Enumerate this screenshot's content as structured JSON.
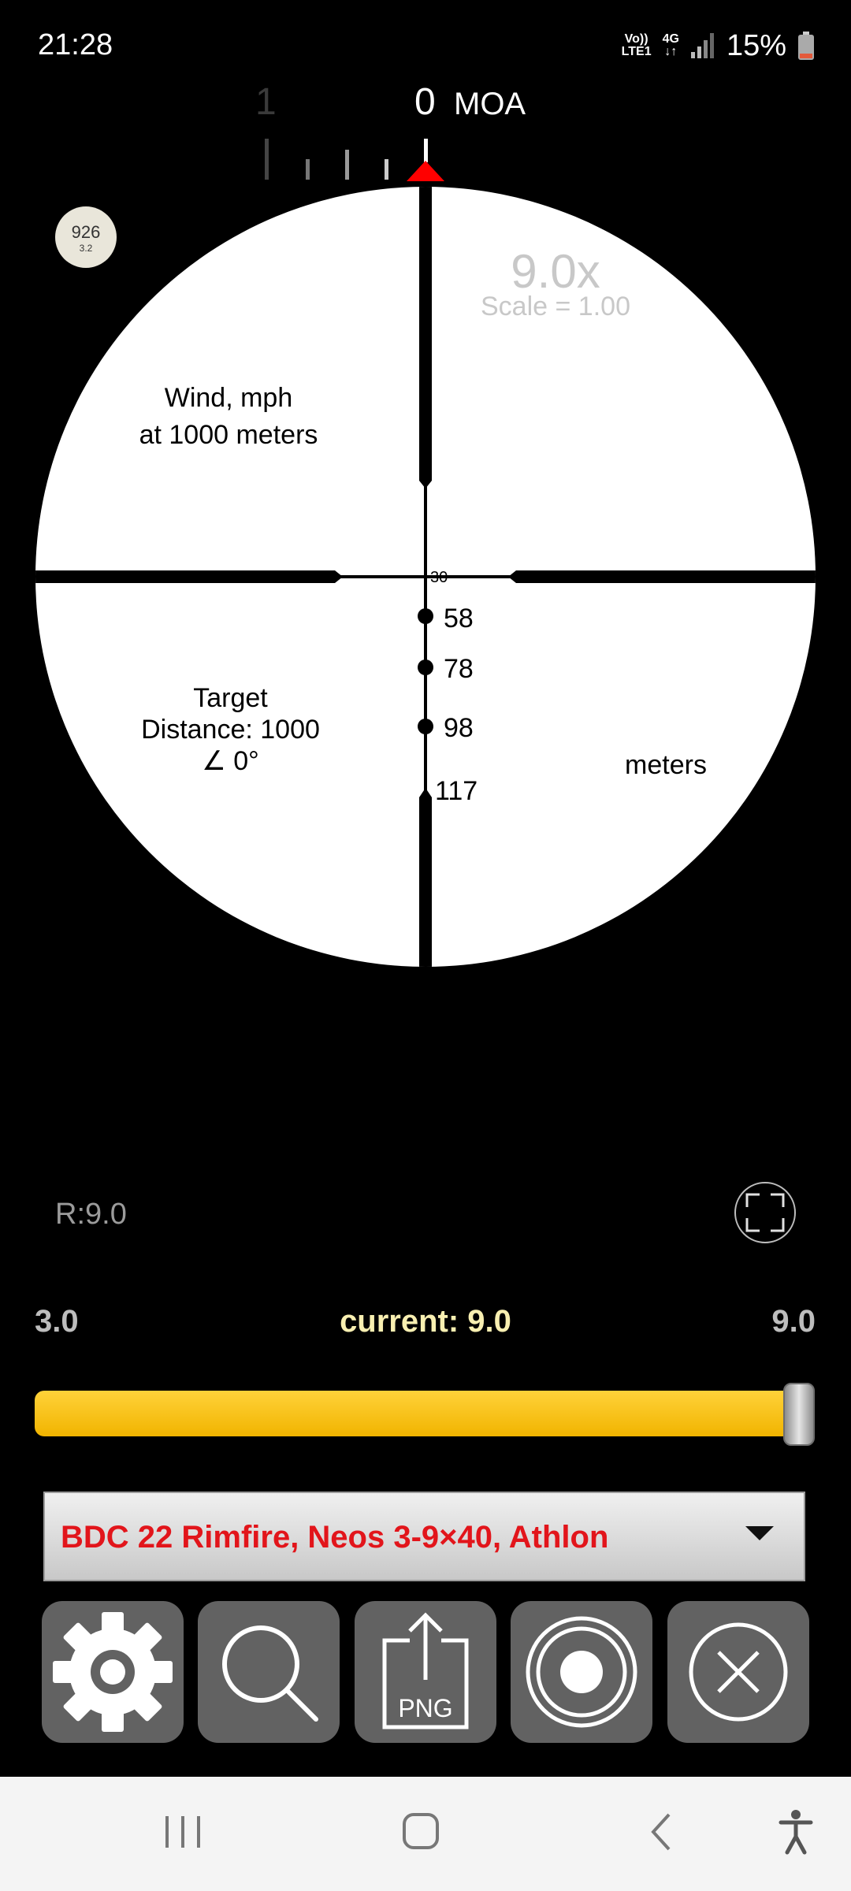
{
  "status_bar": {
    "time": "21:28",
    "volte_top": "Vo))",
    "volte_bottom": "LTE1",
    "network": "4G",
    "battery_percent": "15%"
  },
  "windage_scale": {
    "left_value": "1",
    "center_value": "0",
    "unit": "MOA"
  },
  "badge": {
    "number": "926",
    "sub": "3.2"
  },
  "reticle": {
    "magnification": "9.0x",
    "scale_text": "Scale = 1.00",
    "wind_label_line1": "Wind, mph",
    "wind_label_line2": "at 1000 meters",
    "target_line1": "Target",
    "target_line2": "Distance: 1000",
    "target_line3": "∠ 0°",
    "units_label": "meters",
    "zero_label": "30",
    "drop_marks": [
      "58",
      "78",
      "98",
      "117"
    ]
  },
  "range_readout": "R:9.0",
  "zoom": {
    "min_label": "3.0",
    "current_label": "current: 9.0",
    "max_label": "9.0",
    "current_fraction": 1.0
  },
  "reticle_select": {
    "selected": "BDC 22 Rimfire, Neos 3-9×40, Athlon"
  },
  "toolbar": {
    "export_label": "PNG"
  },
  "colors": {
    "slider": "#f5bd00",
    "dropdown_text": "#e2151b",
    "marker": "#ff0000",
    "current_label": "#f8efb1"
  }
}
